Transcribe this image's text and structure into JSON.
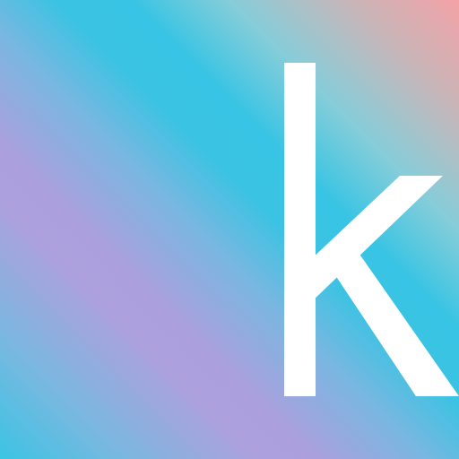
{
  "artwork": {
    "glyph": "k",
    "glyph_color": "#ffffff",
    "gradient_colors": [
      "#f3a2a6",
      "#38c4e4",
      "#ac9fde",
      "#3cc4e3"
    ]
  }
}
